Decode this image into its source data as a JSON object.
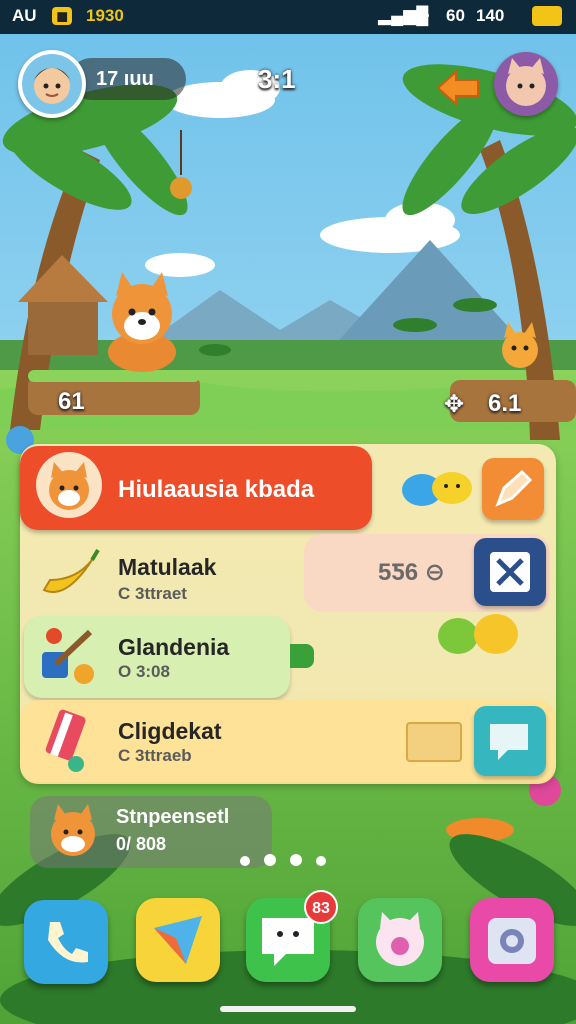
{
  "status_bar": {
    "carrier": "AU",
    "time": "1930",
    "signal_text": "60",
    "time_right": "140"
  },
  "hud": {
    "player_counter": "17 ıuu",
    "match_score": "3:1"
  },
  "scene_labels": {
    "left_score": "61",
    "right_score": "6.1"
  },
  "panel": {
    "header_title": "Hiulaausia kbada",
    "rows": [
      {
        "title": "Matulaak",
        "subtitle": "C 3ttraet",
        "badge": "5Ƽ6 ⊖"
      },
      {
        "title": "Glandenia",
        "subtitle": "O 3:08"
      },
      {
        "title": "Cligdekat",
        "subtitle": "C 3ttraeb"
      }
    ]
  },
  "bottom_widget": {
    "title": "Stnpeensetl",
    "subtitle": "0/ 808"
  },
  "dock": {
    "apps": [
      {
        "name": "phone",
        "badge": ""
      },
      {
        "name": "maps",
        "badge": ""
      },
      {
        "name": "messages",
        "badge": "83"
      },
      {
        "name": "pets",
        "badge": ""
      },
      {
        "name": "camera",
        "badge": ""
      }
    ]
  },
  "colors": {
    "sky_top": "#7cc8ec",
    "grass": "#6cc04a",
    "header_red": "#f0502d",
    "row_yellow": "#fde6a8",
    "row_green": "#d9f0b4",
    "dock_phone": "#34a8e0",
    "dock_maps": "#f6d43a",
    "dock_messages": "#3fc24c",
    "dock_pets": "#56c45c",
    "dock_camera": "#e94aa8"
  }
}
